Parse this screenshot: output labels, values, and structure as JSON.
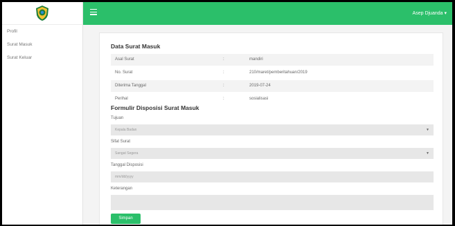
{
  "sidebar": {
    "items": [
      {
        "label": "Profil"
      },
      {
        "label": "Surat Masuk"
      },
      {
        "label": "Surat Keluar"
      }
    ]
  },
  "topbar": {
    "menu_icon": "hamburger-icon",
    "user_name": "Asep Djuanda",
    "user_caret": "▾"
  },
  "data_surat": {
    "title": "Data Surat Masuk",
    "rows": [
      {
        "key": "Asal Surat",
        "sep": ":",
        "value": "mandiri"
      },
      {
        "key": "No. Surat",
        "sep": ":",
        "value": "210/maret/pemberitahuan/2019"
      },
      {
        "key": "Diterima Tanggal",
        "sep": ":",
        "value": "2019-07-24"
      },
      {
        "key": "Perihal",
        "sep": ":",
        "value": "sosialisasi"
      }
    ]
  },
  "form": {
    "title": "Formulir Disposisi Surat Masuk",
    "tujuan_label": "Tujuan",
    "tujuan_value": "Kepala Badan",
    "sifat_label": "Sifat Surat",
    "sifat_value": "Sangat Segera",
    "tanggal_label": "Tanggal Disposisi",
    "tanggal_placeholder": "mm/dd/yyyy",
    "keterangan_label": "Keterangan",
    "keterangan_value": "",
    "submit_label": "Simpan",
    "select_arrow": "▼"
  },
  "colors": {
    "accent": "#2bbf6a"
  }
}
